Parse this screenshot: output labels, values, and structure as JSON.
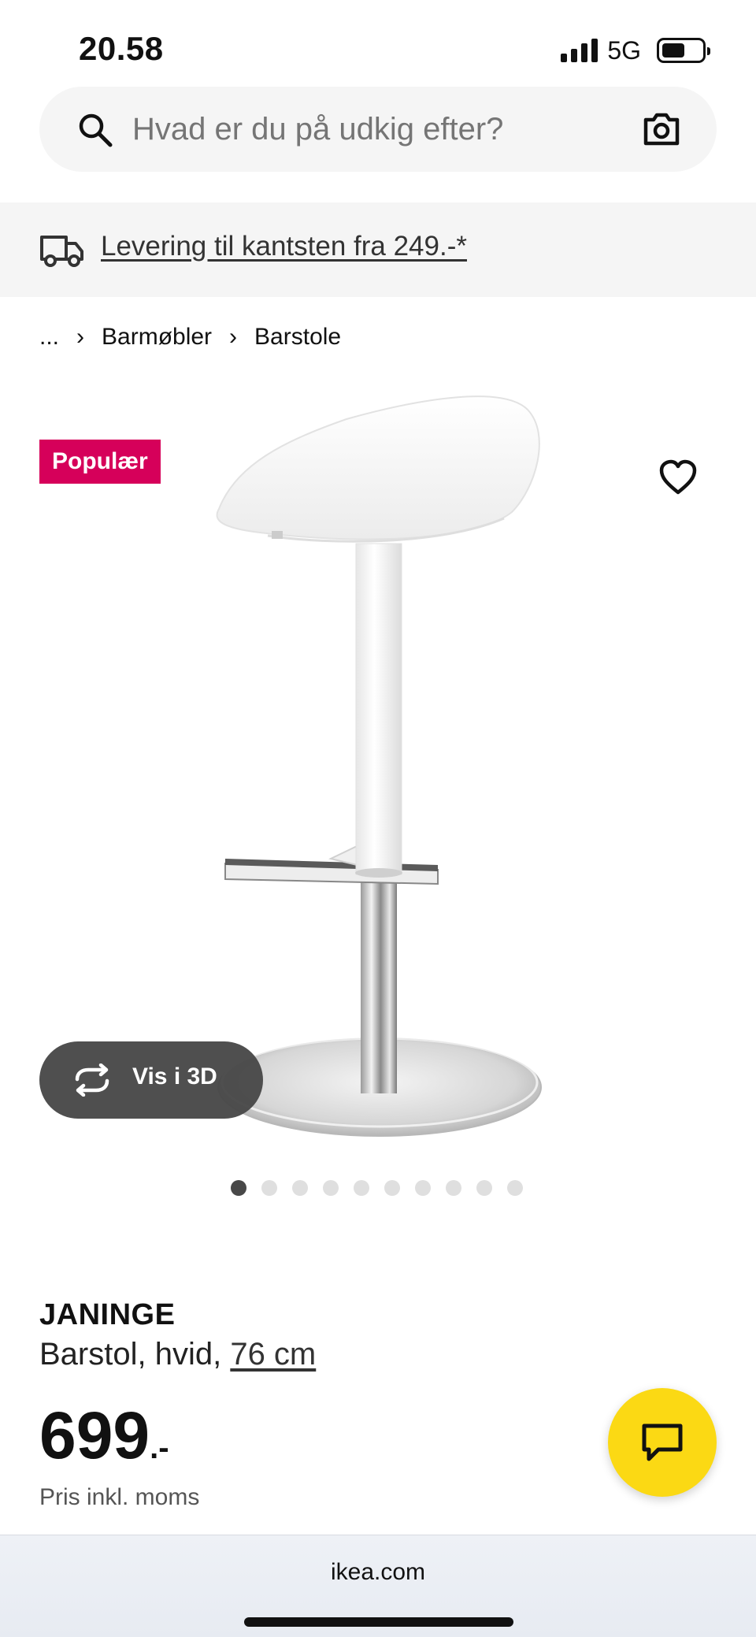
{
  "status_bar": {
    "time": "20.58",
    "network": "5G",
    "battery_level": 0.55
  },
  "search": {
    "placeholder": "Hvad er du på udkig efter?",
    "icon": "search-icon",
    "camera_icon": "camera-icon"
  },
  "delivery": {
    "text": "Levering til kantsten fra 249.-*",
    "icon": "truck-icon"
  },
  "breadcrumb": {
    "items": [
      "...",
      "Barmøbler",
      "Barstole"
    ],
    "separator": "›"
  },
  "product_image": {
    "badge": "Populær",
    "view_3d_label": "Vis i 3D",
    "carousel_count": 10,
    "carousel_active_index": 0
  },
  "product": {
    "name": "JANINGE",
    "description": "Barstol, hvid, ",
    "size_link": "76 cm",
    "price_integer": "699",
    "price_suffix": ".-",
    "price_note": "Pris inkl. moms"
  },
  "browser": {
    "url": "ikea.com"
  },
  "colors": {
    "badge": "#d6005a",
    "chat_button": "#fbd914",
    "surface": "#f5f5f5"
  }
}
